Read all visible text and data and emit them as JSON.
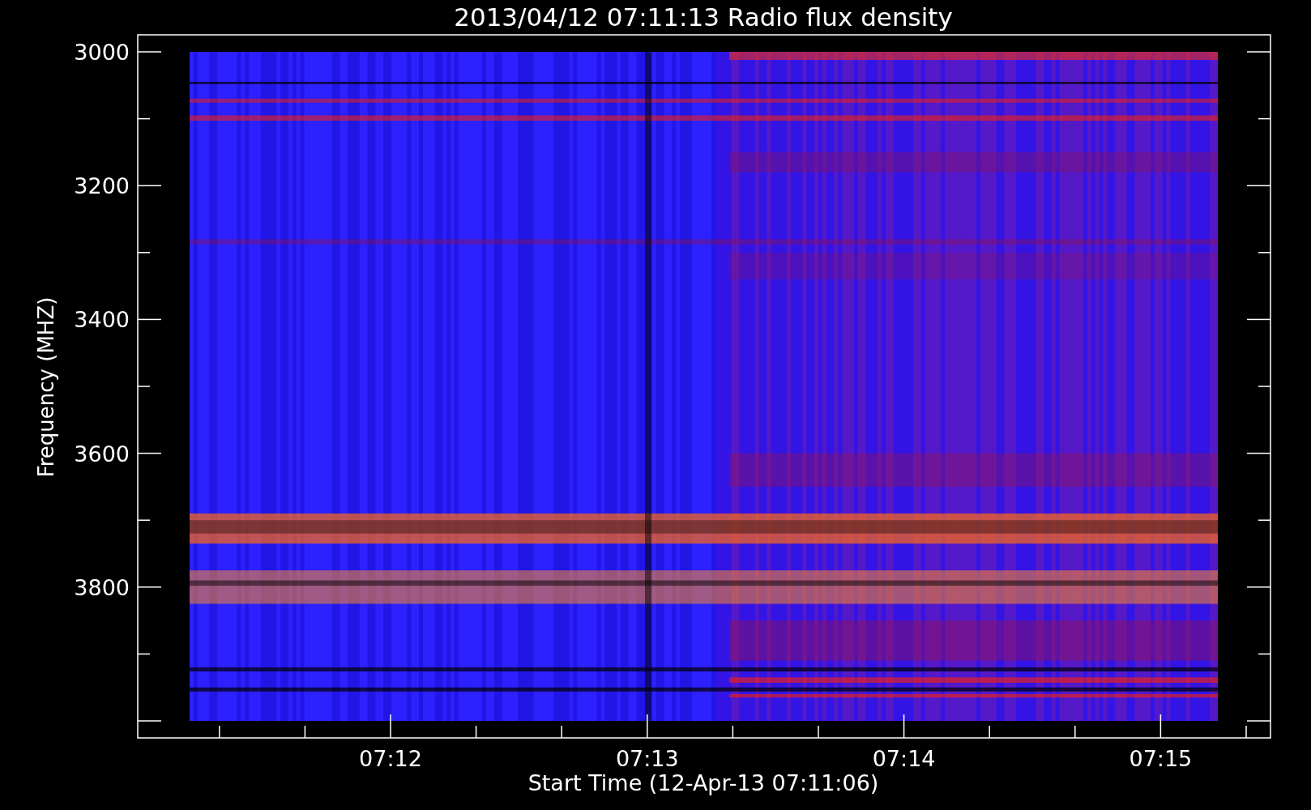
{
  "title": "2013/04/12 07:11:13 Radio flux density",
  "y_axis": {
    "label": "Frequency (MHZ)",
    "ticks": [
      "3000",
      "3200",
      "3400",
      "3600",
      "3800"
    ]
  },
  "x_axis": {
    "label": "Start Time (12-Apr-13 07:11:06)",
    "ticks": [
      "07:12",
      "07:13",
      "07:14",
      "07:15"
    ]
  }
}
